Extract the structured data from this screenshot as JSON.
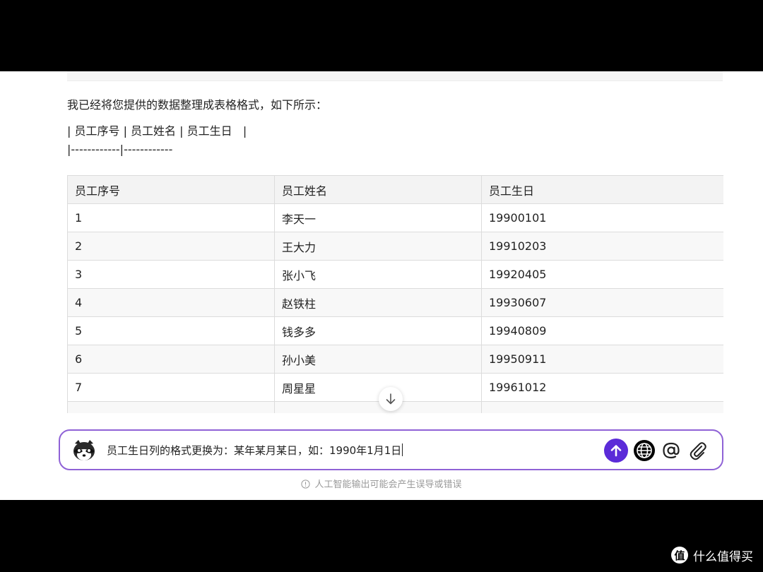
{
  "message": {
    "intro": "我已经将您提供的数据整理成表格格式，如下所示：",
    "markdown_line_1": "| 员工序号 | 员工姓名 | 员工生日   |",
    "markdown_line_2": "|------------|------------"
  },
  "table": {
    "headers": [
      "员工序号",
      "员工姓名",
      "员工生日"
    ],
    "rows": [
      [
        "1",
        "李天一",
        "19900101"
      ],
      [
        "2",
        "王大力",
        "19910203"
      ],
      [
        "3",
        "张小飞",
        "19920405"
      ],
      [
        "4",
        "赵铁柱",
        "19930607"
      ],
      [
        "5",
        "钱多多",
        "19940809"
      ],
      [
        "6",
        "孙小美",
        "19950911"
      ],
      [
        "7",
        "周星星",
        "19961012"
      ],
      [
        "",
        "",
        ""
      ]
    ]
  },
  "input": {
    "value": "员工生日列的格式更换为：某年某月某日，如：1990年1月1日"
  },
  "toolbar": {
    "send_icon": "arrow-up-icon",
    "globe_icon": "globe-icon",
    "at_icon": "at-icon",
    "attach_icon": "paperclip-icon"
  },
  "disclaimer": "人工智能输出可能会产生误导或错误",
  "watermark": {
    "logo_text": "值",
    "text": "什么值得买"
  },
  "colors": {
    "accent": "#5b2bd8",
    "input_border": "#8f62d6"
  }
}
